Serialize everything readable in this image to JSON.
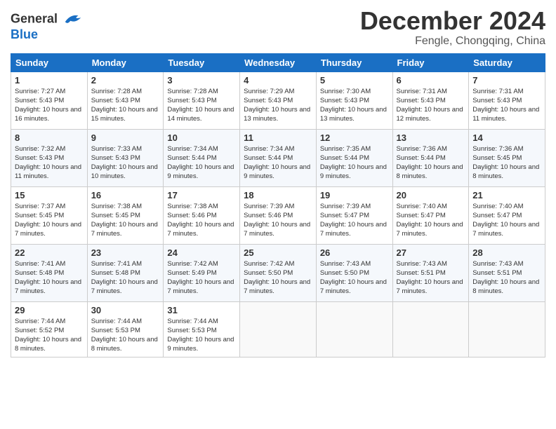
{
  "header": {
    "logo": "GeneralBlue",
    "month_year": "December 2024",
    "location": "Fengle, Chongqing, China"
  },
  "days_of_week": [
    "Sunday",
    "Monday",
    "Tuesday",
    "Wednesday",
    "Thursday",
    "Friday",
    "Saturday"
  ],
  "weeks": [
    [
      {
        "day": "1",
        "sunrise": "7:27 AM",
        "sunset": "5:43 PM",
        "daylight": "10 hours and 16 minutes."
      },
      {
        "day": "2",
        "sunrise": "7:28 AM",
        "sunset": "5:43 PM",
        "daylight": "10 hours and 15 minutes."
      },
      {
        "day": "3",
        "sunrise": "7:28 AM",
        "sunset": "5:43 PM",
        "daylight": "10 hours and 14 minutes."
      },
      {
        "day": "4",
        "sunrise": "7:29 AM",
        "sunset": "5:43 PM",
        "daylight": "10 hours and 13 minutes."
      },
      {
        "day": "5",
        "sunrise": "7:30 AM",
        "sunset": "5:43 PM",
        "daylight": "10 hours and 13 minutes."
      },
      {
        "day": "6",
        "sunrise": "7:31 AM",
        "sunset": "5:43 PM",
        "daylight": "10 hours and 12 minutes."
      },
      {
        "day": "7",
        "sunrise": "7:31 AM",
        "sunset": "5:43 PM",
        "daylight": "10 hours and 11 minutes."
      }
    ],
    [
      {
        "day": "8",
        "sunrise": "7:32 AM",
        "sunset": "5:43 PM",
        "daylight": "10 hours and 11 minutes."
      },
      {
        "day": "9",
        "sunrise": "7:33 AM",
        "sunset": "5:43 PM",
        "daylight": "10 hours and 10 minutes."
      },
      {
        "day": "10",
        "sunrise": "7:34 AM",
        "sunset": "5:44 PM",
        "daylight": "10 hours and 9 minutes."
      },
      {
        "day": "11",
        "sunrise": "7:34 AM",
        "sunset": "5:44 PM",
        "daylight": "10 hours and 9 minutes."
      },
      {
        "day": "12",
        "sunrise": "7:35 AM",
        "sunset": "5:44 PM",
        "daylight": "10 hours and 9 minutes."
      },
      {
        "day": "13",
        "sunrise": "7:36 AM",
        "sunset": "5:44 PM",
        "daylight": "10 hours and 8 minutes."
      },
      {
        "day": "14",
        "sunrise": "7:36 AM",
        "sunset": "5:45 PM",
        "daylight": "10 hours and 8 minutes."
      }
    ],
    [
      {
        "day": "15",
        "sunrise": "7:37 AM",
        "sunset": "5:45 PM",
        "daylight": "10 hours and 7 minutes."
      },
      {
        "day": "16",
        "sunrise": "7:38 AM",
        "sunset": "5:45 PM",
        "daylight": "10 hours and 7 minutes."
      },
      {
        "day": "17",
        "sunrise": "7:38 AM",
        "sunset": "5:46 PM",
        "daylight": "10 hours and 7 minutes."
      },
      {
        "day": "18",
        "sunrise": "7:39 AM",
        "sunset": "5:46 PM",
        "daylight": "10 hours and 7 minutes."
      },
      {
        "day": "19",
        "sunrise": "7:39 AM",
        "sunset": "5:47 PM",
        "daylight": "10 hours and 7 minutes."
      },
      {
        "day": "20",
        "sunrise": "7:40 AM",
        "sunset": "5:47 PM",
        "daylight": "10 hours and 7 minutes."
      },
      {
        "day": "21",
        "sunrise": "7:40 AM",
        "sunset": "5:47 PM",
        "daylight": "10 hours and 7 minutes."
      }
    ],
    [
      {
        "day": "22",
        "sunrise": "7:41 AM",
        "sunset": "5:48 PM",
        "daylight": "10 hours and 7 minutes."
      },
      {
        "day": "23",
        "sunrise": "7:41 AM",
        "sunset": "5:48 PM",
        "daylight": "10 hours and 7 minutes."
      },
      {
        "day": "24",
        "sunrise": "7:42 AM",
        "sunset": "5:49 PM",
        "daylight": "10 hours and 7 minutes."
      },
      {
        "day": "25",
        "sunrise": "7:42 AM",
        "sunset": "5:50 PM",
        "daylight": "10 hours and 7 minutes."
      },
      {
        "day": "26",
        "sunrise": "7:43 AM",
        "sunset": "5:50 PM",
        "daylight": "10 hours and 7 minutes."
      },
      {
        "day": "27",
        "sunrise": "7:43 AM",
        "sunset": "5:51 PM",
        "daylight": "10 hours and 7 minutes."
      },
      {
        "day": "28",
        "sunrise": "7:43 AM",
        "sunset": "5:51 PM",
        "daylight": "10 hours and 8 minutes."
      }
    ],
    [
      {
        "day": "29",
        "sunrise": "7:44 AM",
        "sunset": "5:52 PM",
        "daylight": "10 hours and 8 minutes."
      },
      {
        "day": "30",
        "sunrise": "7:44 AM",
        "sunset": "5:53 PM",
        "daylight": "10 hours and 8 minutes."
      },
      {
        "day": "31",
        "sunrise": "7:44 AM",
        "sunset": "5:53 PM",
        "daylight": "10 hours and 9 minutes."
      },
      null,
      null,
      null,
      null
    ]
  ]
}
